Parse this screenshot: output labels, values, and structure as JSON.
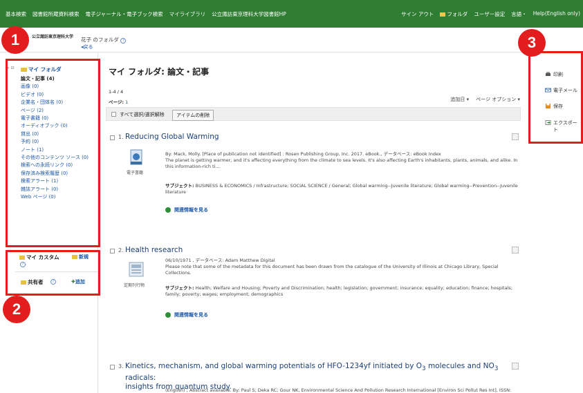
{
  "topnav": {
    "left": [
      "基本検索",
      "図書館所蔵資料検索",
      "電子ジャーナル・電子ブック検索",
      "マイライブラリ",
      "公立諏訪東京理科大学図書館HP"
    ],
    "right": [
      "サイン アウト",
      "フォルダ",
      "ユーザー設定",
      "言語・",
      "Help(English only)"
    ]
  },
  "header": {
    "logo": "公立諏訪東京理科大学",
    "folder_title": "花子 のフォルダ",
    "back": "◂戻る"
  },
  "sidebar": {
    "root": "マイ フォルダ",
    "items": [
      "論文・記事 (4)",
      "画像 (0)",
      "ビデオ (0)",
      "企業名・団体名 (0)",
      "ページ (2)",
      "電子書籍 (0)",
      "オーディオブック (0)",
      "貸出 (0)",
      "予約 (0)",
      "ノート (1)",
      "その他のコンテンツ ソース (0)",
      "検索への永続リンク (0)",
      "保存済み検索履歴 (0)",
      "検索アラート (1)",
      "雑誌アラート (0)",
      "Web ページ (0)"
    ],
    "custom_label": "マイ カスタム",
    "custom_new": "新規",
    "shared_label": "共有者",
    "shared_add": "追加"
  },
  "callouts": [
    "1",
    "2",
    "3"
  ],
  "main": {
    "title": "マイ フォルダ: 論文・記事",
    "range": "1-4 / 4",
    "pages_label": "ページ:",
    "pages_value": "1",
    "sort": "追加日 ▾",
    "page_options": "ページ オプション ▾",
    "select_all": "すべて選択/選択解除",
    "delete_btn": "アイテムの削除",
    "results": [
      {
        "num": "1.",
        "title": "Reducing Global Warming",
        "type": "電子書籍",
        "meta": "By: Mack, Molly. [Place of publication not identified] : Rosen Publishing Group, Inc. 2017. eBook., データベース: eBook Index",
        "abstract": "The planet is getting warmer, and it's affecting everything from the climate to sea levels. It's also affecting Earth's inhabitants, plants, animals, and alike. In this information-rich ti...",
        "subject_label": "サブジェクト:",
        "subjects": " BUSINESS & ECONOMICS / Infrastructure; SOCIAL SCIENCE / General; Global warming--Juvenile literature; Global warming--Prevention--Juvenile literature",
        "related": "関連情報を見る"
      },
      {
        "num": "2.",
        "title": "Health research",
        "type": "定期刊行物",
        "meta": "06/10/1971 , データベース: Adam Matthew Digital",
        "abstract": "Please note that some of the metadata for this document has been drawn from the catalogue of the University of Illinois at Chicago Library, Special Collections.",
        "subject_label": "サブジェクト:",
        "subjects": " Health; Welfare and Housing; Poverty and Discrimination; health; legislation; government; insurance; equality; education; finance; hospitals; family; poverty; wages; employment; demographics",
        "related": "関連情報を見る"
      },
      {
        "num": "3.",
        "title_a": "Kinetics, mechanism, and global warming potentials of HFO-1234yf initiated by O",
        "sub3": "3",
        "title_b": " molecules and NO",
        "title_c": " radicals:",
        "title_line2": "insights from quantum study.",
        "meta": "(English) ; Abstract available. By: Paul S; Deka RC; Gour NK, Environmental Science And Pollution Research International [Environ Sci Pollut Res Int], ISSN:"
      }
    ]
  },
  "rightpanel": {
    "print": "印刷",
    "email": "電子メール",
    "save": "保存",
    "export": "エクスポート"
  }
}
